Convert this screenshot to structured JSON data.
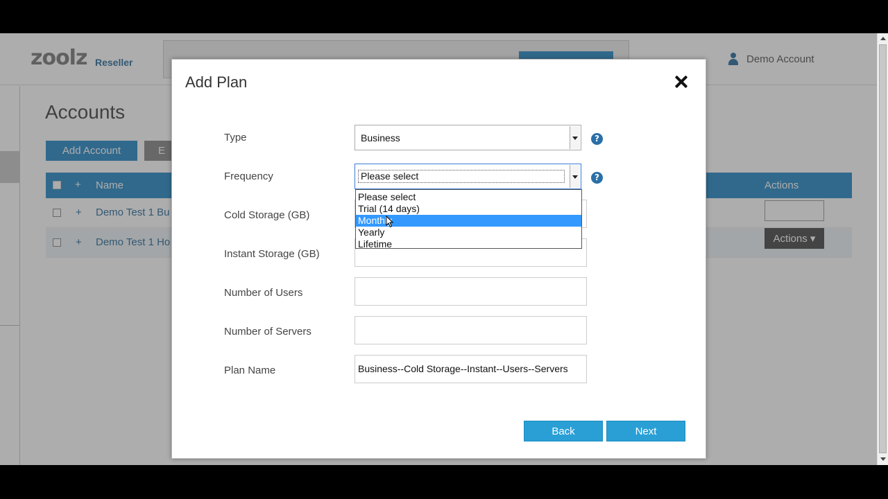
{
  "header": {
    "logo_main": "zoolz",
    "logo_sub": "Reseller",
    "account_label": "Demo Account",
    "account_icon": "user-icon"
  },
  "page": {
    "title": "Accounts",
    "add_account_label": "Add Account",
    "second_button_label": "E"
  },
  "table": {
    "columns": [
      "Name",
      "Actions"
    ],
    "expand_symbol": "+",
    "rows": [
      {
        "name": "Demo Test 1 Bu",
        "action": ""
      },
      {
        "name": "Demo Test 1 Ho",
        "action": "Actions ▾"
      }
    ]
  },
  "modal": {
    "title": "Add Plan",
    "close_icon": "close-icon",
    "fields": {
      "type": {
        "label": "Type",
        "value": "Business"
      },
      "frequency": {
        "label": "Frequency",
        "value": "Please select"
      },
      "cold_storage": {
        "label": "Cold Storage (GB)",
        "value": ""
      },
      "instant_storage": {
        "label": "Instant Storage (GB)",
        "value": ""
      },
      "users": {
        "label": "Number of Users",
        "value": ""
      },
      "servers": {
        "label": "Number of Servers",
        "value": ""
      },
      "plan_name": {
        "label": "Plan Name",
        "value": "Business--Cold Storage--Instant--Users--Servers"
      }
    },
    "help_symbol": "?",
    "frequency_options": [
      "Please select",
      "Trial (14 days)",
      "Monthly",
      "Yearly",
      "Lifetime"
    ],
    "highlighted_option": "Monthly",
    "back_label": "Back",
    "next_label": "Next"
  },
  "colors": {
    "accent": "#2a8bc6",
    "button": "#2a9fd6",
    "highlight": "#3399ff",
    "help": "#2a6fa8"
  }
}
